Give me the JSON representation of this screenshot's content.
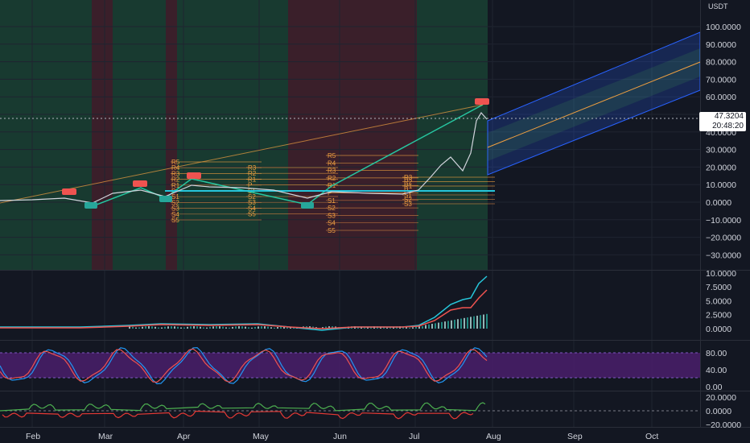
{
  "currency": "USDT",
  "price_axis": [
    "100.0000",
    "90.0000",
    "80.0000",
    "70.0000",
    "60.0000",
    "50.0000",
    "40.0000",
    "30.0000",
    "20.0000",
    "10.0000",
    "0.0000",
    "−10.0000",
    "−20.0000",
    "−30.0000"
  ],
  "macd_axis": [
    "10.0000",
    "7.5000",
    "5.0000",
    "2.5000",
    "0.0000"
  ],
  "stoch_axis": [
    "80.00",
    "40.00",
    "0.00"
  ],
  "osc_axis": [
    "20.0000",
    "0.0000",
    "−20.0000"
  ],
  "last_price": "47.3204",
  "countdown": "20:48:20",
  "months": [
    "Feb",
    "Mar",
    "Apr",
    "May",
    "Jun",
    "Jul",
    "Aug",
    "Sep",
    "Oct"
  ],
  "pivot_left": [
    "R5",
    "R4",
    "R3",
    "R2",
    "R1",
    "P",
    "S1",
    "S2",
    "S3",
    "S4",
    "S5"
  ],
  "pivot_right": [
    "R5",
    "R4",
    "R3",
    "R2",
    "R1",
    "P",
    "S1",
    "S2",
    "S3",
    "S4",
    "S5"
  ],
  "pivot_mid": [
    "R3",
    "R2",
    "R1",
    "P",
    "S1",
    "S2",
    "S3",
    "S4",
    "S5"
  ],
  "colors": {
    "background": "#131722",
    "bull_zone": "#1b3a32",
    "bear_zone": "#3a1f2a",
    "channel_blue": "#2962ff",
    "trend_green": "#26c6a0",
    "pivot_orange": "#f0a040",
    "macd_teal": "#26c6da",
    "signal_red": "#ef5350",
    "stoch_band": "#4a1f6b"
  },
  "chart_data": {
    "type": "line",
    "title": "",
    "x": [
      "Feb",
      "Mar",
      "Apr",
      "May",
      "Jun",
      "Jul",
      "Aug",
      "Sep",
      "Oct"
    ],
    "ylim": [
      -35,
      105
    ],
    "series": [
      {
        "values": [
          1.5,
          2.0,
          6.0,
          8.0,
          5.0,
          4.5,
          47.3
        ]
      }
    ]
  }
}
